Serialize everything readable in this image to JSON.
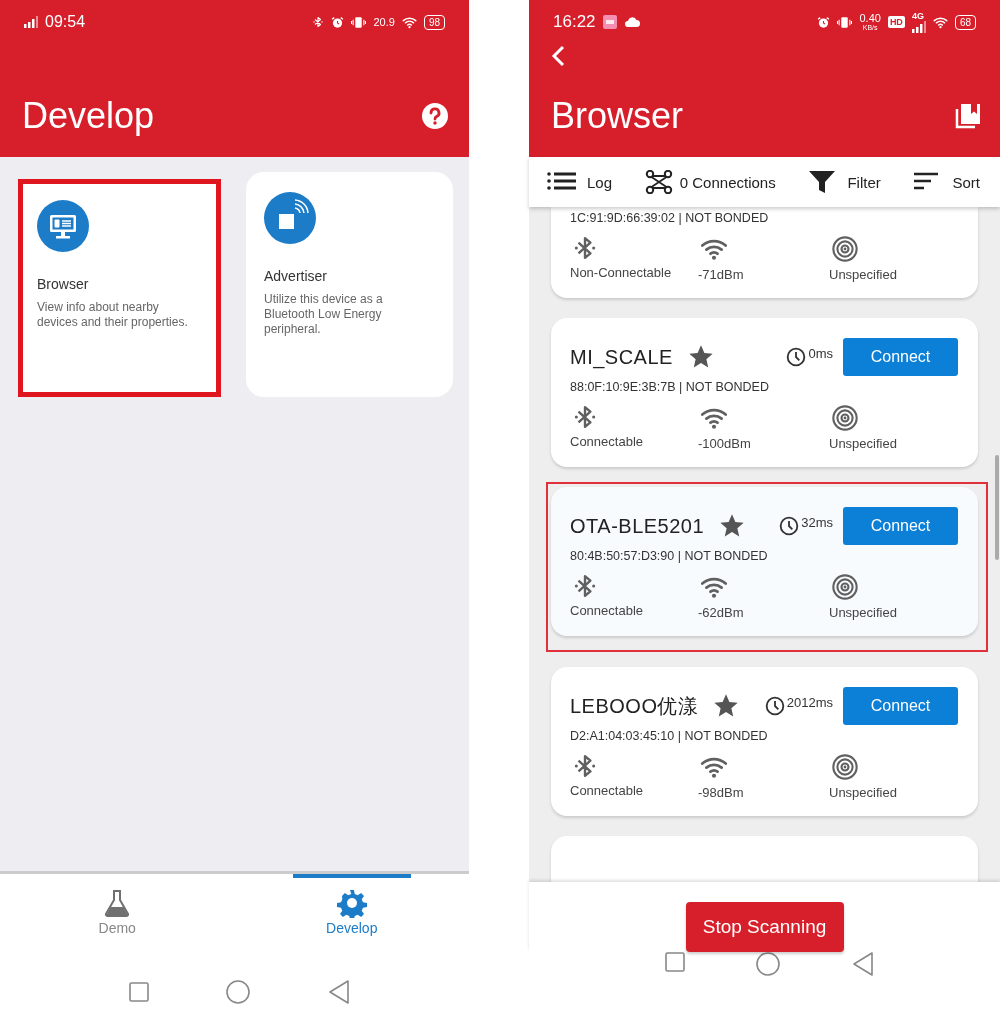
{
  "develop_screen": {
    "status_bar": {
      "time": "09:54",
      "net_speed": "20.9",
      "battery": "98"
    },
    "app_bar": {
      "title": "Develop"
    },
    "tiles": [
      {
        "title": "Browser",
        "description": "View info about nearby devices and their properties.",
        "highlighted": true
      },
      {
        "title": "Advertiser",
        "description": "Utilize this device as a Bluetooth Low Energy peripheral.",
        "highlighted": false
      }
    ],
    "bottom_nav": [
      {
        "label": "Demo",
        "selected": false
      },
      {
        "label": "Develop",
        "selected": true
      }
    ]
  },
  "browser_screen": {
    "status_bar": {
      "time": "16:22",
      "net_speed": "0.40",
      "net_unit": "KB/s",
      "hd": "HD",
      "network": "4G",
      "battery": "68"
    },
    "app_bar": {
      "title": "Browser"
    },
    "toolbar": [
      {
        "label": "Log"
      },
      {
        "label": "0 Connections"
      },
      {
        "label": "Filter"
      },
      {
        "label": "Sort"
      }
    ],
    "devices": [
      {
        "kind": "partial",
        "address": "1C:91:9D:66:39:02 | NOT BONDED",
        "connectable": "Non-Connectable",
        "rssi": "-71dBm",
        "type": "Unspecified",
        "highlighted": false
      },
      {
        "kind": "full",
        "name": "MI_SCALE",
        "interval": "0ms",
        "button": "Connect",
        "address": "88:0F:10:9E:3B:7B | NOT BONDED",
        "connectable": "Connectable",
        "rssi": "-100dBm",
        "type": "Unspecified",
        "highlighted": false
      },
      {
        "kind": "full",
        "name": "OTA-BLE5201",
        "interval": "32ms",
        "button": "Connect",
        "address": "80:4B:50:57:D3:90 | NOT BONDED",
        "connectable": "Connectable",
        "rssi": "-62dBm",
        "type": "Unspecified",
        "highlighted": true
      },
      {
        "kind": "full",
        "name": "LEBOOO优漾",
        "interval": "2012ms",
        "button": "Connect",
        "address": "D2:A1:04:03:45:10 | NOT BONDED",
        "connectable": "Connectable",
        "rssi": "-98dBm",
        "type": "Unspecified",
        "highlighted": false
      }
    ],
    "scan_button": "Stop Scanning"
  }
}
